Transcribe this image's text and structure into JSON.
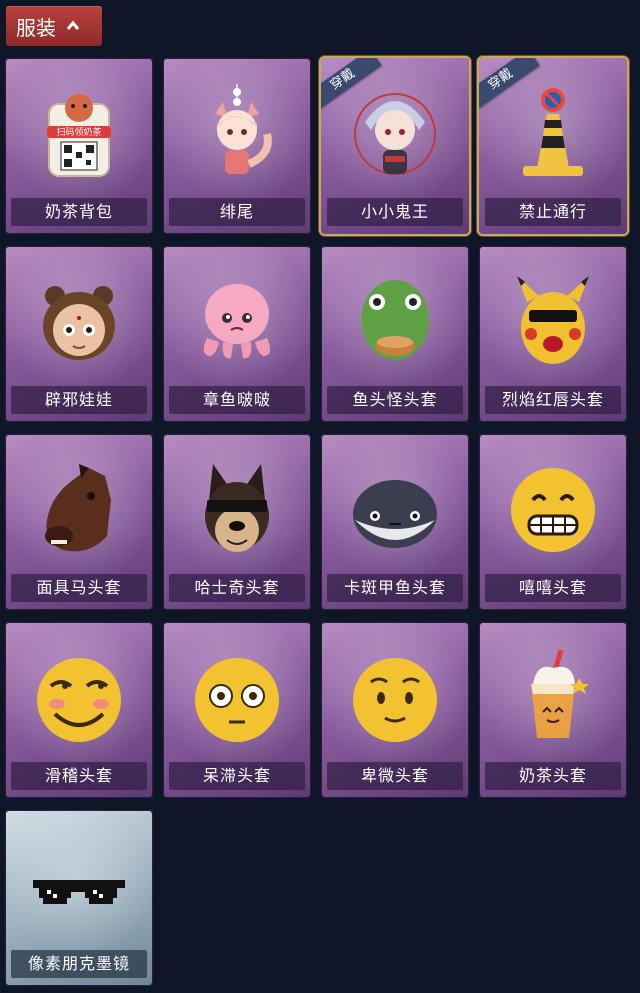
{
  "header": {
    "title": "服装"
  },
  "items": [
    {
      "label": "奶茶背包",
      "worn": false,
      "badge": "",
      "icon": "milk-tea-backpack-icon",
      "qr_text": "扫码领奶茶"
    },
    {
      "label": "绯尾",
      "worn": false,
      "badge": "",
      "icon": "fox-girl-charm-icon"
    },
    {
      "label": "小小鬼王",
      "worn": true,
      "badge": "穿戴",
      "icon": "little-ghost-king-icon"
    },
    {
      "label": "禁止通行",
      "worn": true,
      "badge": "穿戴",
      "icon": "traffic-cone-icon"
    },
    {
      "label": "辟邪娃娃",
      "worn": false,
      "badge": "",
      "icon": "doll-icon"
    },
    {
      "label": "章鱼啵啵",
      "worn": false,
      "badge": "",
      "icon": "octopus-icon"
    },
    {
      "label": "鱼头怪头套",
      "worn": false,
      "badge": "",
      "icon": "fish-head-icon"
    },
    {
      "label": "烈焰红唇头套",
      "worn": false,
      "badge": "",
      "icon": "pikachu-mask-icon"
    },
    {
      "label": "面具马头套",
      "worn": false,
      "badge": "",
      "icon": "horse-mask-icon"
    },
    {
      "label": "哈士奇头套",
      "worn": false,
      "badge": "",
      "icon": "husky-mask-icon"
    },
    {
      "label": "卡斑甲鱼头套",
      "worn": false,
      "badge": "",
      "icon": "fish-ball-icon"
    },
    {
      "label": "嘻嘻头套",
      "worn": false,
      "badge": "",
      "icon": "grin-emoji-icon"
    },
    {
      "label": "滑稽头套",
      "worn": false,
      "badge": "",
      "icon": "funny-emoji-icon"
    },
    {
      "label": "呆滞头套",
      "worn": false,
      "badge": "",
      "icon": "blank-stare-emoji-icon"
    },
    {
      "label": "卑微头套",
      "worn": false,
      "badge": "",
      "icon": "pleading-emoji-icon"
    },
    {
      "label": "奶茶头套",
      "worn": false,
      "badge": "",
      "icon": "milk-tea-cup-icon"
    },
    {
      "label": "像素朋克墨镜",
      "worn": false,
      "badge": "",
      "icon": "pixel-sunglasses-icon"
    }
  ]
}
